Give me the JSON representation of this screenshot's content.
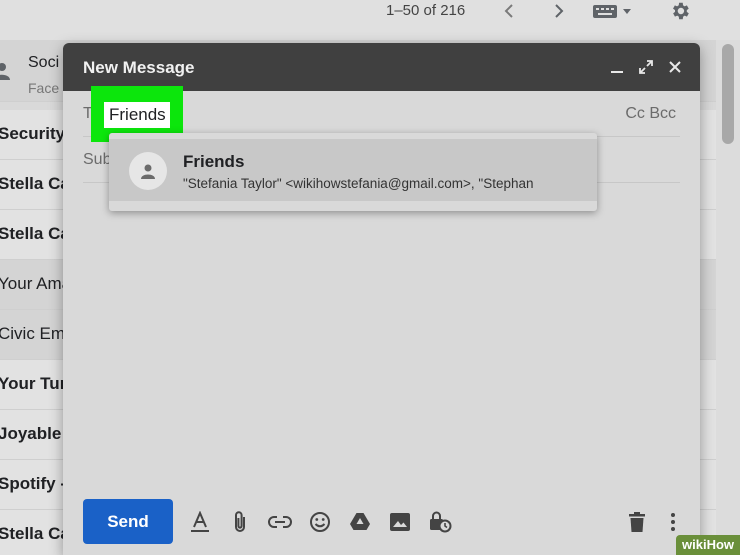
{
  "inbox": {
    "pager": "1–50 of 216",
    "social": {
      "title": "Soci",
      "subtitle": "Face"
    },
    "rows": [
      {
        "sender": "Security",
        "unread": true
      },
      {
        "sender": "Stella Ca",
        "unread": true
      },
      {
        "sender": "Stella Ca",
        "unread": true
      },
      {
        "sender": "Your Ama",
        "unread": false
      },
      {
        "sender": "Civic Ema",
        "unread": false
      },
      {
        "sender": "Your Tun",
        "unread": true
      },
      {
        "sender": "Joyable I",
        "unread": true
      },
      {
        "sender": "Spotify -",
        "unread": true
      },
      {
        "sender": "Stella Ca",
        "unread": true
      }
    ]
  },
  "compose": {
    "title": "New Message",
    "to_label": "T",
    "to_chip": "Friends",
    "cc_label": "Cc",
    "bcc_label": "Bcc",
    "subject_label": "Sub",
    "suggestion": {
      "name": "Friends",
      "emails": "\"Stefania Taylor\" <wikihowstefania@gmail.com>, \"Stephan"
    },
    "send_label": "Send"
  },
  "icons": {
    "header": [
      "minimize-icon",
      "expand-icon",
      "close-icon"
    ],
    "toolbar": [
      "formatting-icon",
      "attach-icon",
      "link-icon",
      "emoji-icon",
      "drive-icon",
      "photo-icon",
      "confidential-icon",
      "delete-icon",
      "more-options-icon"
    ]
  },
  "colors": {
    "highlight": "#0ce60c",
    "send_button": "#1a61c7",
    "compose_header": "#404040"
  },
  "watermark": "wikiHow"
}
